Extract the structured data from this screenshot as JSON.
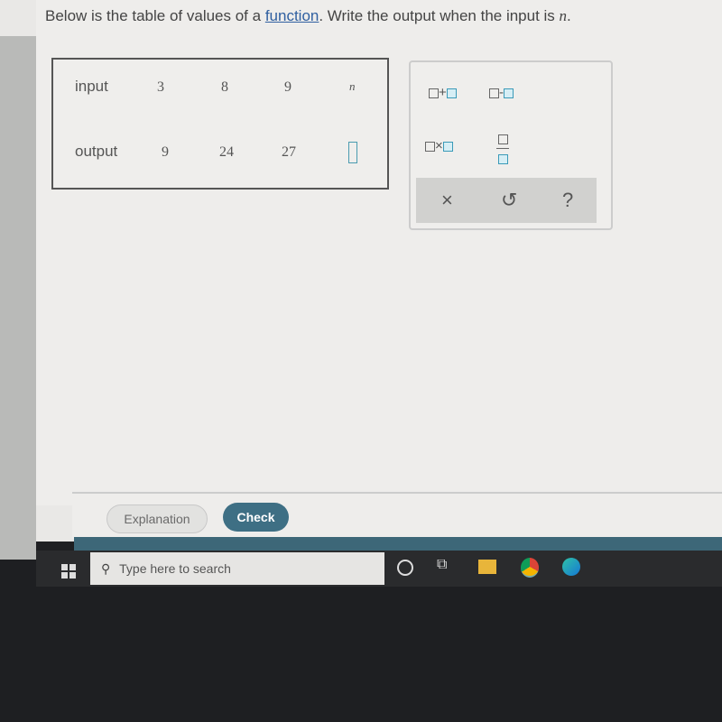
{
  "question": {
    "before": "Below is the table of values of a ",
    "link": "function",
    "after": ". Write the output when the input is ",
    "var": "n",
    "end": "."
  },
  "table": {
    "input_label": "input",
    "output_label": "output",
    "inputs": [
      "3",
      "8",
      "9",
      "n"
    ],
    "outputs": [
      "9",
      "24",
      "27",
      ""
    ]
  },
  "keypad": {
    "add": "+",
    "subtract": "-",
    "multiply": "×",
    "clear": "×",
    "undo": "↺",
    "help": "?"
  },
  "buttons": {
    "explanation": "Explanation",
    "check": "Check"
  },
  "taskbar": {
    "search_placeholder": "Type here to search"
  },
  "colors": {
    "accent": "#3e6f84",
    "answer_box": "#4a9bb0"
  }
}
